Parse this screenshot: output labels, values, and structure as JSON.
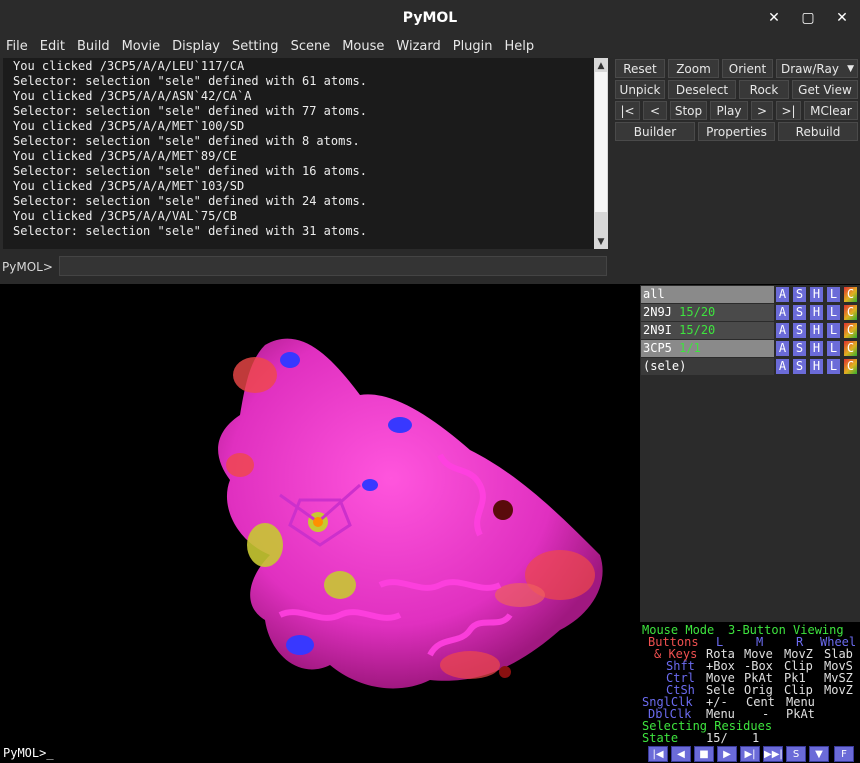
{
  "window": {
    "title": "PyMOL"
  },
  "menu": [
    "File",
    "Edit",
    "Build",
    "Movie",
    "Display",
    "Setting",
    "Scene",
    "Mouse",
    "Wizard",
    "Plugin",
    "Help"
  ],
  "log": [
    "You clicked /3CP5/A/A/LEU`117/CA",
    "Selector: selection \"sele\" defined with 61 atoms.",
    "You clicked /3CP5/A/A/ASN`42/CA`A",
    "Selector: selection \"sele\" defined with 77 atoms.",
    "You clicked /3CP5/A/A/MET`100/SD",
    "Selector: selection \"sele\" defined with 8 atoms.",
    "You clicked /3CP5/A/A/MET`89/CE",
    "Selector: selection \"sele\" defined with 16 atoms.",
    "You clicked /3CP5/A/A/MET`103/SD",
    "Selector: selection \"sele\" defined with 24 atoms.",
    "You clicked /3CP5/A/A/VAL`75/CB",
    "Selector: selection \"sele\" defined with 31 atoms."
  ],
  "command": {
    "prompt": "PyMOL>",
    "value": ""
  },
  "buttons": {
    "reset": "Reset",
    "zoom": "Zoom",
    "orient": "Orient",
    "drawray": "Draw/Ray",
    "unpick": "Unpick",
    "deselect": "Deselect",
    "rock": "Rock",
    "getview": "Get View",
    "first": "|<",
    "prev": "<",
    "stop": "Stop",
    "play": "Play",
    "next": ">",
    "last": ">|",
    "mclear": "MClear",
    "builder": "Builder",
    "properties": "Properties",
    "rebuild": "Rebuild"
  },
  "objects": [
    {
      "name": "all",
      "state": ""
    },
    {
      "name": "2N9J",
      "state": "15/20"
    },
    {
      "name": "2N9I",
      "state": "15/20"
    },
    {
      "name": "3CP5",
      "state": "1/1"
    },
    {
      "name": "(sele)",
      "state": ""
    }
  ],
  "object_buttons": [
    "A",
    "S",
    "H",
    "L",
    "C"
  ],
  "mouse": {
    "mode_label": "Mouse Mode",
    "mode_value": "3-Button Viewing",
    "buttons_label": "Buttons",
    "col_l": "L",
    "col_m": "M",
    "col_r": "R",
    "col_wheel": "Wheel",
    "keys_label": "& Keys",
    "row_none": [
      "Rota",
      "Move",
      "MovZ",
      "Slab"
    ],
    "shft_label": "Shft",
    "row_shft": [
      "+Box",
      "-Box",
      "Clip",
      "MovS"
    ],
    "ctrl_label": "Ctrl",
    "row_ctrl": [
      "Move",
      "PkAt",
      "Pk1",
      "MvSZ"
    ],
    "ctsh_label": "CtSh",
    "row_ctsh": [
      "Sele",
      "Orig",
      "Clip",
      "MovZ"
    ],
    "snglclk_label": "SnglClk",
    "row_snglclk": [
      "+/-",
      "Cent",
      "Menu"
    ],
    "dblclk_label": "DblClk",
    "row_dblclk": [
      "Menu",
      "-",
      "PkAt"
    ],
    "selecting": "Selecting Residues",
    "state_label": "State",
    "state_value": "15/",
    "state_total": "1"
  },
  "bottom_prompt": "PyMOL>_",
  "vcr": [
    "|◀",
    "◀",
    "■",
    "▶",
    "▶|",
    "▶▶|",
    "S",
    "▼",
    "F"
  ]
}
